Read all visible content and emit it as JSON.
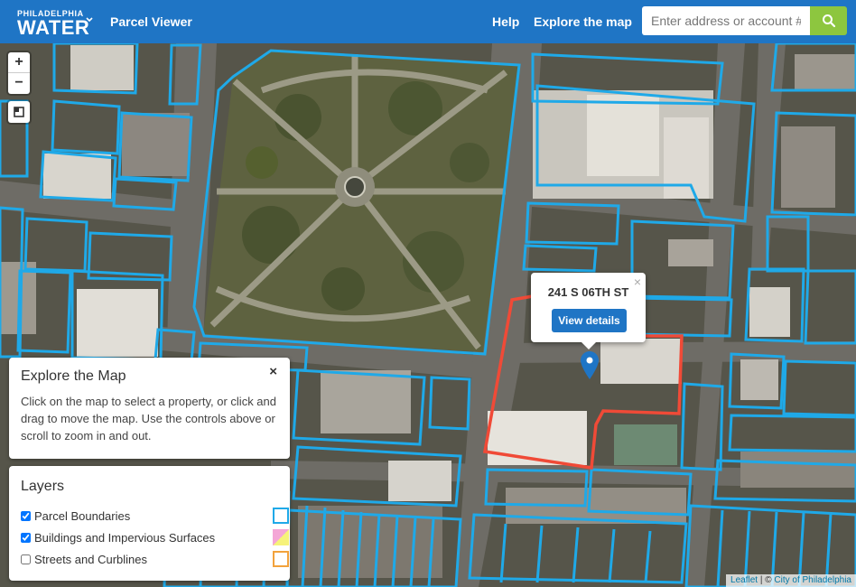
{
  "header": {
    "brand_small": "PHILADELPHIA",
    "brand_big": "WATER",
    "app_title": "Parcel Viewer",
    "nav": [
      "Help",
      "Explore the map"
    ],
    "search_placeholder": "Enter address or account #"
  },
  "map": {
    "zoom_in": "+",
    "zoom_out": "−",
    "popup": {
      "address": "241 S 06TH ST",
      "button": "View details",
      "close": "×"
    },
    "parcel_color": "#1fa9e8",
    "selected_color": "#f04a37"
  },
  "explore_panel": {
    "title": "Explore the Map",
    "body": "Click on the map to select a property, or click and drag to move the map. Use the controls above or scroll to zoom in and out.",
    "close": "×"
  },
  "layers_panel": {
    "title": "Layers",
    "items": [
      {
        "label": "Parcel Boundaries",
        "checked": true,
        "swatch_color": "#1fa9e8"
      },
      {
        "label": "Buildings and Impervious Surfaces",
        "checked": true,
        "swatch_color": "#f4a6d6"
      },
      {
        "label": "Streets and Curblines",
        "checked": false,
        "swatch_color": "#f2a23c"
      }
    ]
  },
  "attribution": {
    "leaflet": "Leaflet",
    "separator": " | © ",
    "source": "City of Philadelphia"
  }
}
